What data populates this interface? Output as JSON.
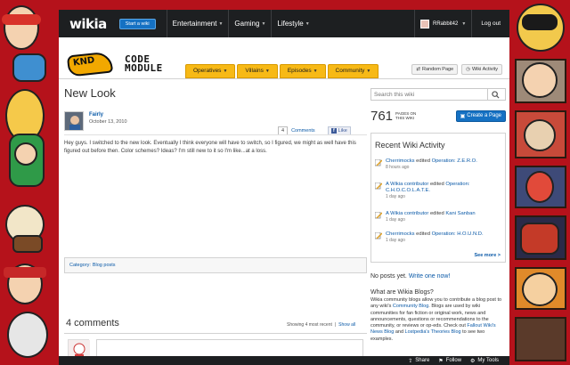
{
  "global_nav": {
    "logo": "wikia",
    "start_wiki": "Start a wiki",
    "hubs": [
      "Entertainment",
      "Gaming",
      "Lifestyle"
    ],
    "username": "RRabbit42",
    "logout": "Log out"
  },
  "wiki_header": {
    "logo_top": "KND",
    "logo_line1": "CODE",
    "logo_line2": "MODULE",
    "nav": [
      "Operatives",
      "Villains",
      "Episodes",
      "Community"
    ],
    "random_page": "Random Page",
    "wiki_activity": "Wiki Activity"
  },
  "article": {
    "title": "New Look",
    "author": "Fairly",
    "date": "October 13, 2010",
    "comment_count": "4",
    "comments_label": "Comments",
    "like_label": "Like",
    "body": "Hey guys. I switched to the new look. Eventually I think everyone will have to switch, so I figured, we might as well have this figured out before then. Color schemes? Ideas? I'm still new to it so I'm like...at a loss.",
    "category_prefix": "Category:",
    "category": "Blog posts",
    "comments_heading": "4 comments",
    "showing": "Showing 4 most recent",
    "show_all": "Show all"
  },
  "rail": {
    "search_placeholder": "Search this wiki",
    "pages_count": "761",
    "pages_label": "PAGES ON THIS WIKI",
    "create_page": "Create a Page",
    "activity_heading": "Recent Wiki Activity",
    "activity": [
      {
        "user": "Cherrimocks",
        "action": "edited",
        "page": "Operation: Z.E.R.O.",
        "time": "8 hours ago"
      },
      {
        "user": "A Wikia contributor",
        "action": "edited",
        "page": "Operation: C.H.O.C.O.L.A.T.E.",
        "time": "1 day ago"
      },
      {
        "user": "A Wikia contributor",
        "action": "edited",
        "page": "Kani Sanban",
        "time": "1 day ago"
      },
      {
        "user": "Cherrimocks",
        "action": "edited",
        "page": "Operation: H.O.U.N.D.",
        "time": "1 day ago"
      }
    ],
    "see_more": "See more >",
    "no_posts": "No posts yet.",
    "write_one": "Write one now!",
    "blogs_heading": "What are Wikia Blogs?",
    "blogs_p1": "Wikia community blogs allow you to contribute a blog post to any wiki's",
    "blogs_link1": "Community Blog",
    "blogs_p2": "Blogs are used by wiki communities for fan fiction or original work, news and announcements, questions or recommendations to the community, or reviews or op-eds. Check out",
    "blogs_link2": "Fallout Wiki's News Blog",
    "blogs_and": "and",
    "blogs_link3": "Lostpedia's Theories Blog",
    "blogs_end": "to see two examples."
  },
  "toolbar": {
    "share": "Share",
    "follow": "Follow",
    "my_tools": "My Tools"
  },
  "colors": {
    "background": "#b5121b",
    "accent_tab": "#f7b916",
    "link": "#0b5aa8",
    "button_blue": "#1571c3"
  }
}
